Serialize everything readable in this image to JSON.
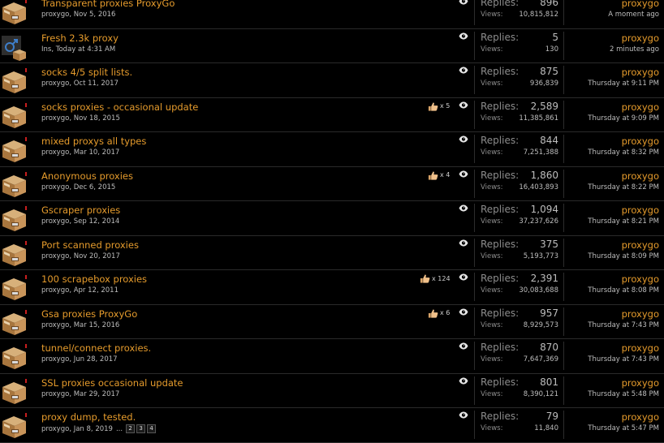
{
  "labels": {
    "replies": "Replies:",
    "views": "Views:"
  },
  "threads": [
    {
      "title": "Transparent proxies ProxyGo",
      "author": "proxygo",
      "date": "Nov 5, 2016",
      "likes": "",
      "replies": "896",
      "views": "10,815,812",
      "last_user": "proxygo",
      "last_time": "A moment ago",
      "avatar": "box-avatar-icon",
      "pages": []
    },
    {
      "title": "Fresh 2.3k proxy",
      "author": "Ins",
      "date": "Today at 4:31 AM",
      "likes": "",
      "replies": "5",
      "views": "130",
      "last_user": "proxygo",
      "last_time": "2 minutes ago",
      "avatar": "male-symbol-avatar-icon",
      "pages": []
    },
    {
      "title": "socks 4/5 split lists.",
      "author": "proxygo",
      "date": "Oct 11, 2017",
      "likes": "",
      "replies": "875",
      "views": "936,839",
      "last_user": "proxygo",
      "last_time": "Thursday at 9:11 PM",
      "avatar": "box-avatar-icon",
      "pages": []
    },
    {
      "title": "socks proxies - occasional update",
      "author": "proxygo",
      "date": "Nov 18, 2015",
      "likes": "x 5",
      "replies": "2,589",
      "views": "11,385,861",
      "last_user": "proxygo",
      "last_time": "Thursday at 9:09 PM",
      "avatar": "box-avatar-icon",
      "pages": []
    },
    {
      "title": "mixed proxys all types",
      "author": "proxygo",
      "date": "Mar 10, 2017",
      "likes": "",
      "replies": "844",
      "views": "7,251,388",
      "last_user": "proxygo",
      "last_time": "Thursday at 8:32 PM",
      "avatar": "box-avatar-icon",
      "pages": []
    },
    {
      "title": "Anonymous proxies",
      "author": "proxygo",
      "date": "Dec 6, 2015",
      "likes": "x 4",
      "replies": "1,860",
      "views": "16,403,893",
      "last_user": "proxygo",
      "last_time": "Thursday at 8:22 PM",
      "avatar": "box-avatar-icon",
      "pages": []
    },
    {
      "title": "Gscraper proxies",
      "author": "proxygo",
      "date": "Sep 12, 2014",
      "likes": "",
      "replies": "1,094",
      "views": "37,237,626",
      "last_user": "proxygo",
      "last_time": "Thursday at 8:21 PM",
      "avatar": "box-avatar-icon",
      "pages": []
    },
    {
      "title": "Port scanned proxies",
      "author": "proxygo",
      "date": "Nov 20, 2017",
      "likes": "",
      "replies": "375",
      "views": "5,193,773",
      "last_user": "proxygo",
      "last_time": "Thursday at 8:09 PM",
      "avatar": "box-avatar-icon",
      "pages": []
    },
    {
      "title": "100 scrapebox proxies",
      "author": "proxygo",
      "date": "Apr 12, 2011",
      "likes": "x 124",
      "replies": "2,391",
      "views": "30,083,688",
      "last_user": "proxygo",
      "last_time": "Thursday at 8:08 PM",
      "avatar": "box-avatar-icon",
      "pages": []
    },
    {
      "title": "Gsa proxies ProxyGo",
      "author": "proxygo",
      "date": "Mar 15, 2016",
      "likes": "x 6",
      "replies": "957",
      "views": "8,929,573",
      "last_user": "proxygo",
      "last_time": "Thursday at 7:43 PM",
      "avatar": "box-avatar-icon",
      "pages": []
    },
    {
      "title": "tunnel/connect proxies.",
      "author": "proxygo",
      "date": "Jun 28, 2017",
      "likes": "",
      "replies": "870",
      "views": "7,647,369",
      "last_user": "proxygo",
      "last_time": "Thursday at 7:43 PM",
      "avatar": "box-avatar-icon",
      "pages": []
    },
    {
      "title": "SSL proxies occasional update",
      "author": "proxygo",
      "date": "Mar 29, 2017",
      "likes": "",
      "replies": "801",
      "views": "8,390,121",
      "last_user": "proxygo",
      "last_time": "Thursday at 5:48 PM",
      "avatar": "box-avatar-icon",
      "pages": []
    },
    {
      "title": "proxy dump, tested.",
      "author": "proxygo",
      "date": "Jan 8, 2019",
      "likes": "",
      "replies": "79",
      "views": "11,840",
      "last_user": "proxygo",
      "last_time": "Thursday at 5:47 PM",
      "avatar": "box-avatar-icon",
      "pages": [
        "...",
        "2",
        "3",
        "4"
      ]
    }
  ],
  "colors": {
    "link": "#e59b2c",
    "meta": "#bdbdbd",
    "label": "#8c8c8c",
    "background": "#000000"
  }
}
